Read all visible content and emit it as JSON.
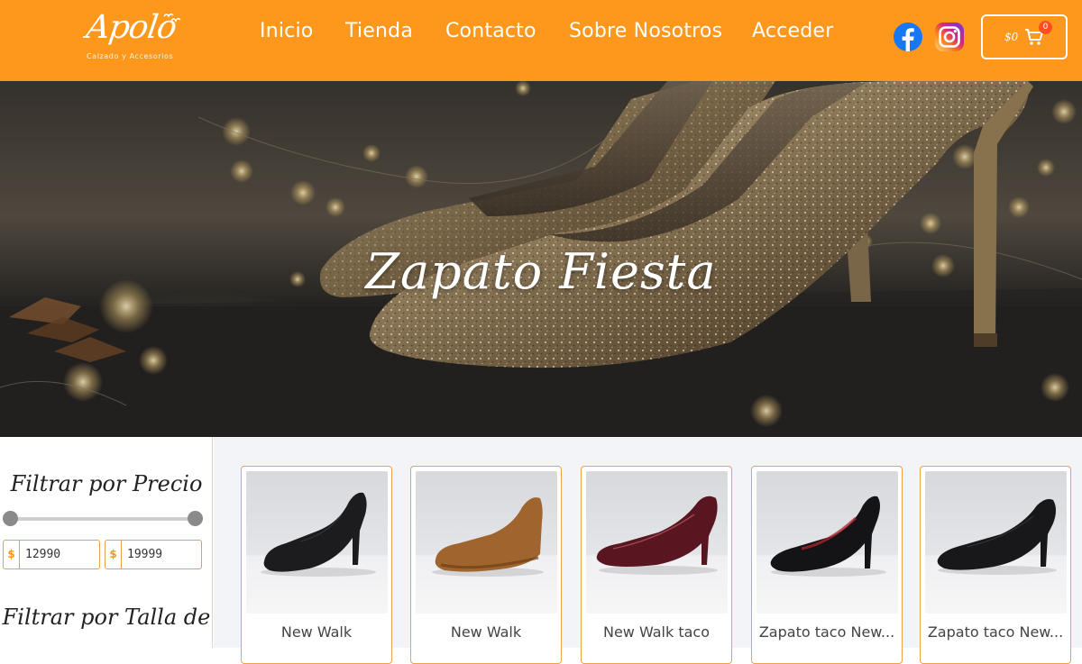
{
  "brand": {
    "name": "Apolo",
    "tagline": "Calzado y Accesorios",
    "color": "#fd981c"
  },
  "nav": {
    "items": [
      {
        "label": "Inicio"
      },
      {
        "label": "Tienda"
      },
      {
        "label": "Contacto"
      },
      {
        "label": "Sobre Nosotros"
      },
      {
        "label": "Acceder"
      }
    ]
  },
  "social": {
    "facebook_icon": "facebook-icon",
    "instagram_icon": "instagram-icon"
  },
  "cart": {
    "amount": "$0",
    "count": "0",
    "icon": "cart-icon"
  },
  "hero": {
    "title": "Zapato Fiesta"
  },
  "sidebar": {
    "price_filter_title": "Filtrar por Precio",
    "currency_symbol": "$",
    "min_price": "12990",
    "max_price": "19999",
    "size_filter_title": "Filtrar por Talla de"
  },
  "products": [
    {
      "name": "New Walk",
      "shoe_color": "#1c1c1e",
      "style": "black-suede-pump"
    },
    {
      "name": "New Walk",
      "shoe_color": "#a0652e",
      "style": "tan-wedge"
    },
    {
      "name": "New Walk taco",
      "shoe_color": "#5a1620",
      "style": "burgundy-patent-pump"
    },
    {
      "name": "Zapato taco New...",
      "shoe_color": "#141416",
      "style": "black-patent-pump"
    },
    {
      "name": "Zapato taco New...",
      "shoe_color": "#18181a",
      "style": "black-leather-pump"
    }
  ]
}
